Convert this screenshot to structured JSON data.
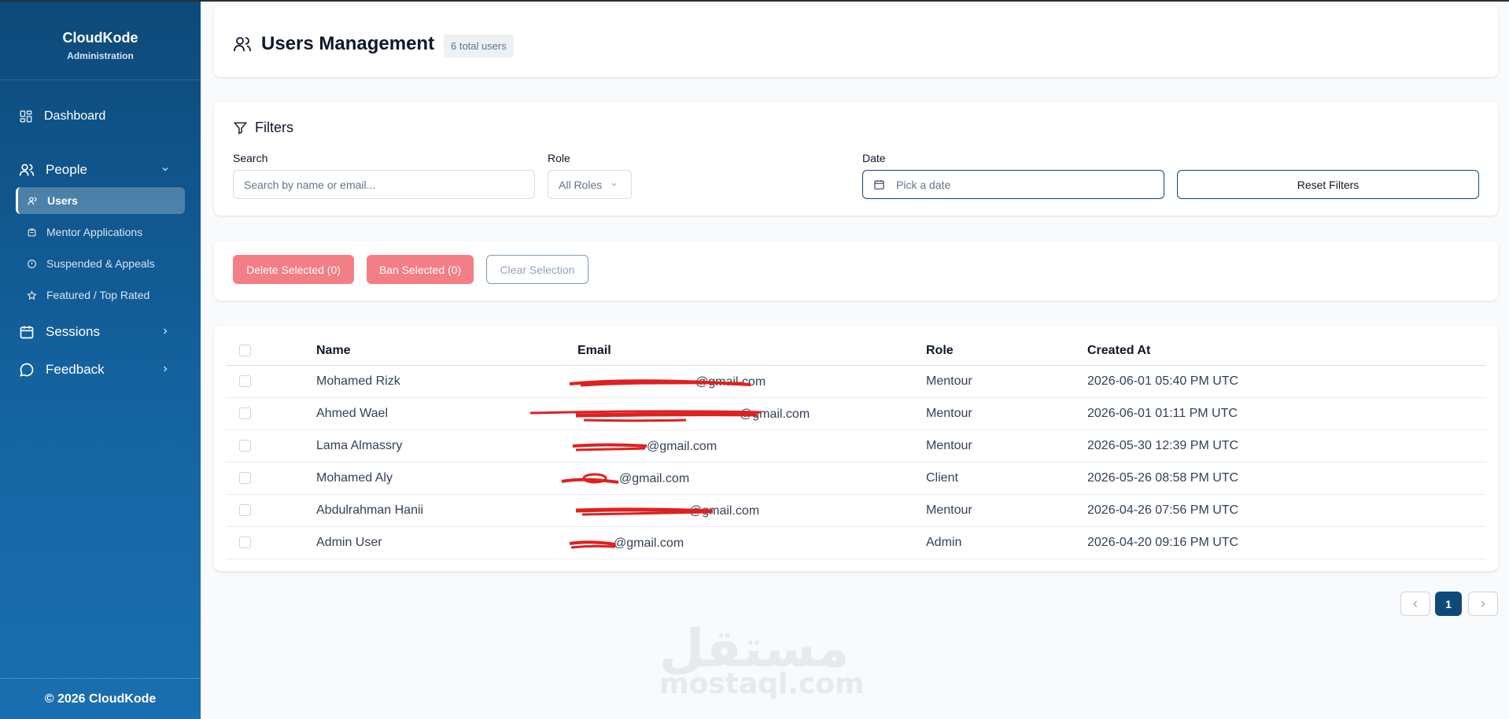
{
  "brand": {
    "name": "CloudKode",
    "subtitle": "Administration"
  },
  "sidebar": {
    "dashboard": "Dashboard",
    "people": "People",
    "people_items": [
      "Users",
      "Mentor Applications",
      "Suspended & Appeals",
      "Featured / Top Rated"
    ],
    "sessions": "Sessions",
    "feedback": "Feedback",
    "footer": "© 2026 CloudKode"
  },
  "header": {
    "title": "Users Management",
    "badge": "6 total users"
  },
  "filters": {
    "title": "Filters",
    "search_label": "Search",
    "search_placeholder": "Search by name or email...",
    "role_label": "Role",
    "role_value": "All Roles",
    "date_label": "Date",
    "date_placeholder": "Pick a date",
    "reset_label": "Reset Filters"
  },
  "actions": {
    "delete_label": "Delete Selected (0)",
    "ban_label": "Ban Selected (0)",
    "clear_label": "Clear Selection"
  },
  "table": {
    "columns": [
      "Name",
      "Email",
      "Role",
      "Created At"
    ],
    "rows": [
      {
        "name": "Mohamed Rizk",
        "email": "@gmail.com",
        "role": "Mentour",
        "created": "2026-06-01 05:40 PM UTC"
      },
      {
        "name": "Ahmed Wael",
        "email": "@gmail.com",
        "role": "Mentour",
        "created": "2026-06-01 01:11 PM UTC"
      },
      {
        "name": "Lama Almassry",
        "email": "@gmail.com",
        "role": "Mentour",
        "created": "2026-05-30 12:39 PM UTC"
      },
      {
        "name": "Mohamed Aly",
        "email": "@gmail.com",
        "role": "Client",
        "created": "2026-05-26 08:58 PM UTC"
      },
      {
        "name": "Abdulrahman Hanii",
        "email": "@gmail.com",
        "role": "Mentour",
        "created": "2026-04-26 07:56 PM UTC"
      },
      {
        "name": "Admin User",
        "email": "@gmail.com",
        "role": "Admin",
        "created": "2026-04-20 09:16 PM UTC"
      }
    ]
  },
  "pagination": {
    "prev": "‹",
    "current": "1",
    "next": "›"
  },
  "watermark": {
    "arabic": "مستقل",
    "latin": "mostaql.com"
  },
  "colors": {
    "primary": "#0d4a7a",
    "danger": "#f47e86",
    "scribble": "#e02020"
  }
}
